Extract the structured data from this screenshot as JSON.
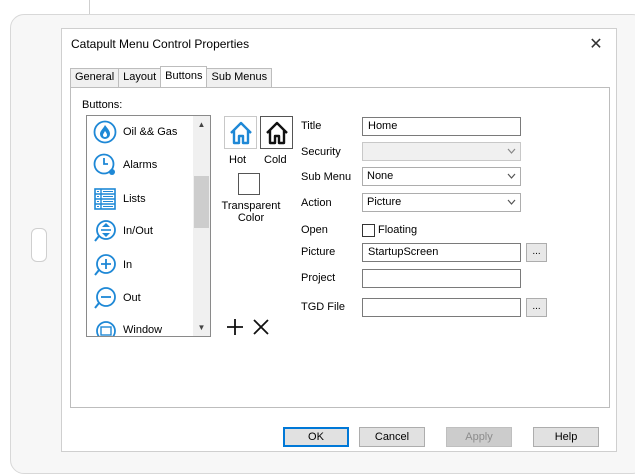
{
  "dialog": {
    "title": "Catapult Menu Control Properties",
    "close_glyph": "✕"
  },
  "tabs": [
    {
      "label": "General",
      "active": false
    },
    {
      "label": "Layout",
      "active": false
    },
    {
      "label": "Buttons",
      "active": true
    },
    {
      "label": "Sub Menus",
      "active": false
    }
  ],
  "buttons_panel": {
    "list_label": "Buttons:",
    "items": [
      {
        "label": "Oil && Gas",
        "icon": "flame-icon"
      },
      {
        "label": "Alarms",
        "icon": "alarm-clock-icon"
      },
      {
        "label": "Lists",
        "icon": "grid-list-icon"
      },
      {
        "label": "In/Out",
        "icon": "in-out-icon"
      },
      {
        "label": "In",
        "icon": "plus-circle-icon"
      },
      {
        "label": "Out",
        "icon": "minus-circle-icon"
      },
      {
        "label": "Window",
        "icon": "window-icon"
      }
    ],
    "hot_label": "Hot",
    "cold_label": "Cold",
    "transparent_label_1": "Transparent",
    "transparent_label_2": "Color"
  },
  "form": {
    "title_label": "Title",
    "title_value": "Home",
    "security_label": "Security",
    "security_value": "",
    "submenu_label": "Sub Menu",
    "submenu_value": "None",
    "action_label": "Action",
    "action_value": "Picture",
    "open_label": "Open",
    "floating_label": "Floating",
    "floating_checked": false,
    "picture_label": "Picture",
    "picture_value": "StartupScreen",
    "project_label": "Project",
    "project_value": "",
    "tgd_label": "TGD File",
    "tgd_value": "",
    "browse_label": "..."
  },
  "footer": {
    "ok": "OK",
    "cancel": "Cancel",
    "apply": "Apply",
    "help": "Help"
  },
  "colors": {
    "icon_blue": "#1e88d6",
    "accent": "#0078d7"
  }
}
